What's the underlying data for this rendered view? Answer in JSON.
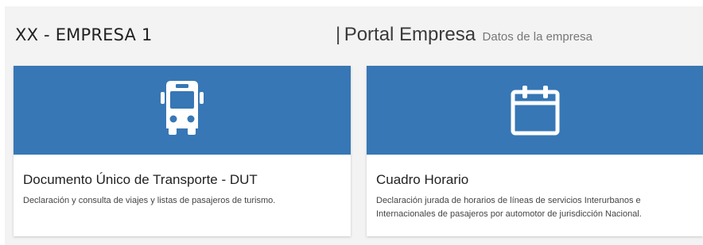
{
  "header": {
    "company_name": "XX - EMPRESA 1",
    "separator": "|",
    "portal_title": "Portal Empresa",
    "portal_subtitle": "Datos de la empresa"
  },
  "cards": [
    {
      "icon": "bus-icon",
      "title": "Documento Único de Transporte - DUT",
      "description": "Declaración y consulta de viajes y listas de pasajeros de turismo."
    },
    {
      "icon": "calendar-icon",
      "title": "Cuadro Horario",
      "description": "Declaración jurada de horarios de líneas de servicios Interurbanos e Internacionales de pasajeros por automotor de jurisdicción Nacional."
    }
  ],
  "colors": {
    "banner": "#3777b5",
    "background": "#f3f3f3",
    "card": "#ffffff"
  }
}
